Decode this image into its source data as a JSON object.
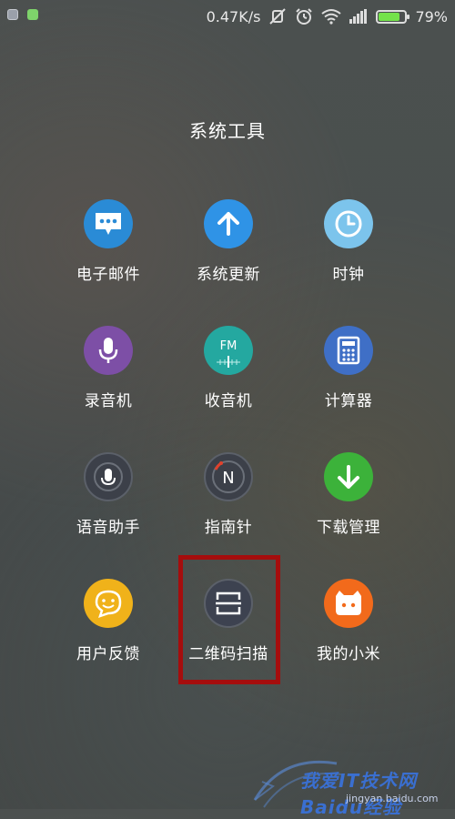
{
  "status_bar": {
    "speed": "0.47K/s",
    "battery_percent": "79%",
    "battery_level": 0.79,
    "icons": [
      "shield-icon",
      "android-icon",
      "mute-icon",
      "alarm-icon",
      "wifi-icon",
      "signal-icon",
      "battery-icon"
    ]
  },
  "folder": {
    "title": "系统工具"
  },
  "apps": [
    {
      "label": "电子邮件",
      "icon": "email-icon",
      "color": "#2a8bd6"
    },
    {
      "label": "系统更新",
      "icon": "update-icon",
      "color": "#2f93e6"
    },
    {
      "label": "时钟",
      "icon": "clock-icon",
      "color": "#7cc4ec"
    },
    {
      "label": "录音机",
      "icon": "microphone-icon",
      "color": "#7d4fa6"
    },
    {
      "label": "收音机",
      "icon": "fm-radio-icon",
      "color": "#24a8a0"
    },
    {
      "label": "计算器",
      "icon": "calculator-icon",
      "color": "#3f6fc6"
    },
    {
      "label": "语音助手",
      "icon": "voice-assistant-icon",
      "color": "#3c4049"
    },
    {
      "label": "指南针",
      "icon": "compass-icon",
      "color": "#3c4049"
    },
    {
      "label": "下载管理",
      "icon": "download-icon",
      "color": "#3cb23a"
    },
    {
      "label": "用户反馈",
      "icon": "feedback-icon",
      "color": "#f0b21a"
    },
    {
      "label": "二维码扫描",
      "icon": "qr-scan-icon",
      "color": "#3d4250"
    },
    {
      "label": "我的小米",
      "icon": "mi-icon",
      "color": "#f26a1b"
    }
  ],
  "watermark": {
    "text": "我爱IT技术网 Baidu经验",
    "url": "jingyan.baidu.com"
  }
}
